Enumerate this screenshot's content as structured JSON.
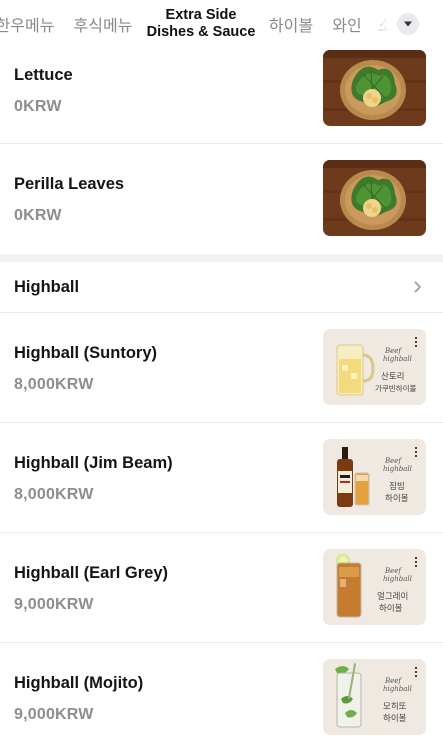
{
  "tabs": [
    {
      "label": "한우메뉴",
      "active": false
    },
    {
      "label": "후식메뉴",
      "active": false
    },
    {
      "label_line1": "Extra Side",
      "label_line2": "Dishes & Sauce",
      "active": true
    },
    {
      "label": "하이볼",
      "active": false
    },
    {
      "label": "와인",
      "active": false
    },
    {
      "label": "소",
      "active": false
    }
  ],
  "side_items": [
    {
      "name": "Lettuce",
      "price": "0KRW",
      "image": "perilla-leaves-plate-photo"
    },
    {
      "name": "Perilla Leaves",
      "price": "0KRW",
      "image": "perilla-leaves-plate-photo"
    }
  ],
  "section": {
    "title": "Highball"
  },
  "highball_items": [
    {
      "name": "Highball (Suntory)",
      "price": "8,000KRW",
      "image_text_1": "산토리",
      "image_text_2": "가쿠빈하이볼"
    },
    {
      "name": "Highball (Jim Beam)",
      "price": "8,000KRW",
      "image_text_1": "짐빔",
      "image_text_2": "하이볼"
    },
    {
      "name": "Highball (Earl Grey)",
      "price": "9,000KRW",
      "image_text_1": "얼그레이",
      "image_text_2": "하이볼"
    },
    {
      "name": "Highball (Mojito)",
      "price": "9,000KRW",
      "image_text_1": "모히또",
      "image_text_2": "하이볼"
    }
  ],
  "colors": {
    "accent": "#111111",
    "muted": "#8e8e8e",
    "divider": "#ededed"
  }
}
